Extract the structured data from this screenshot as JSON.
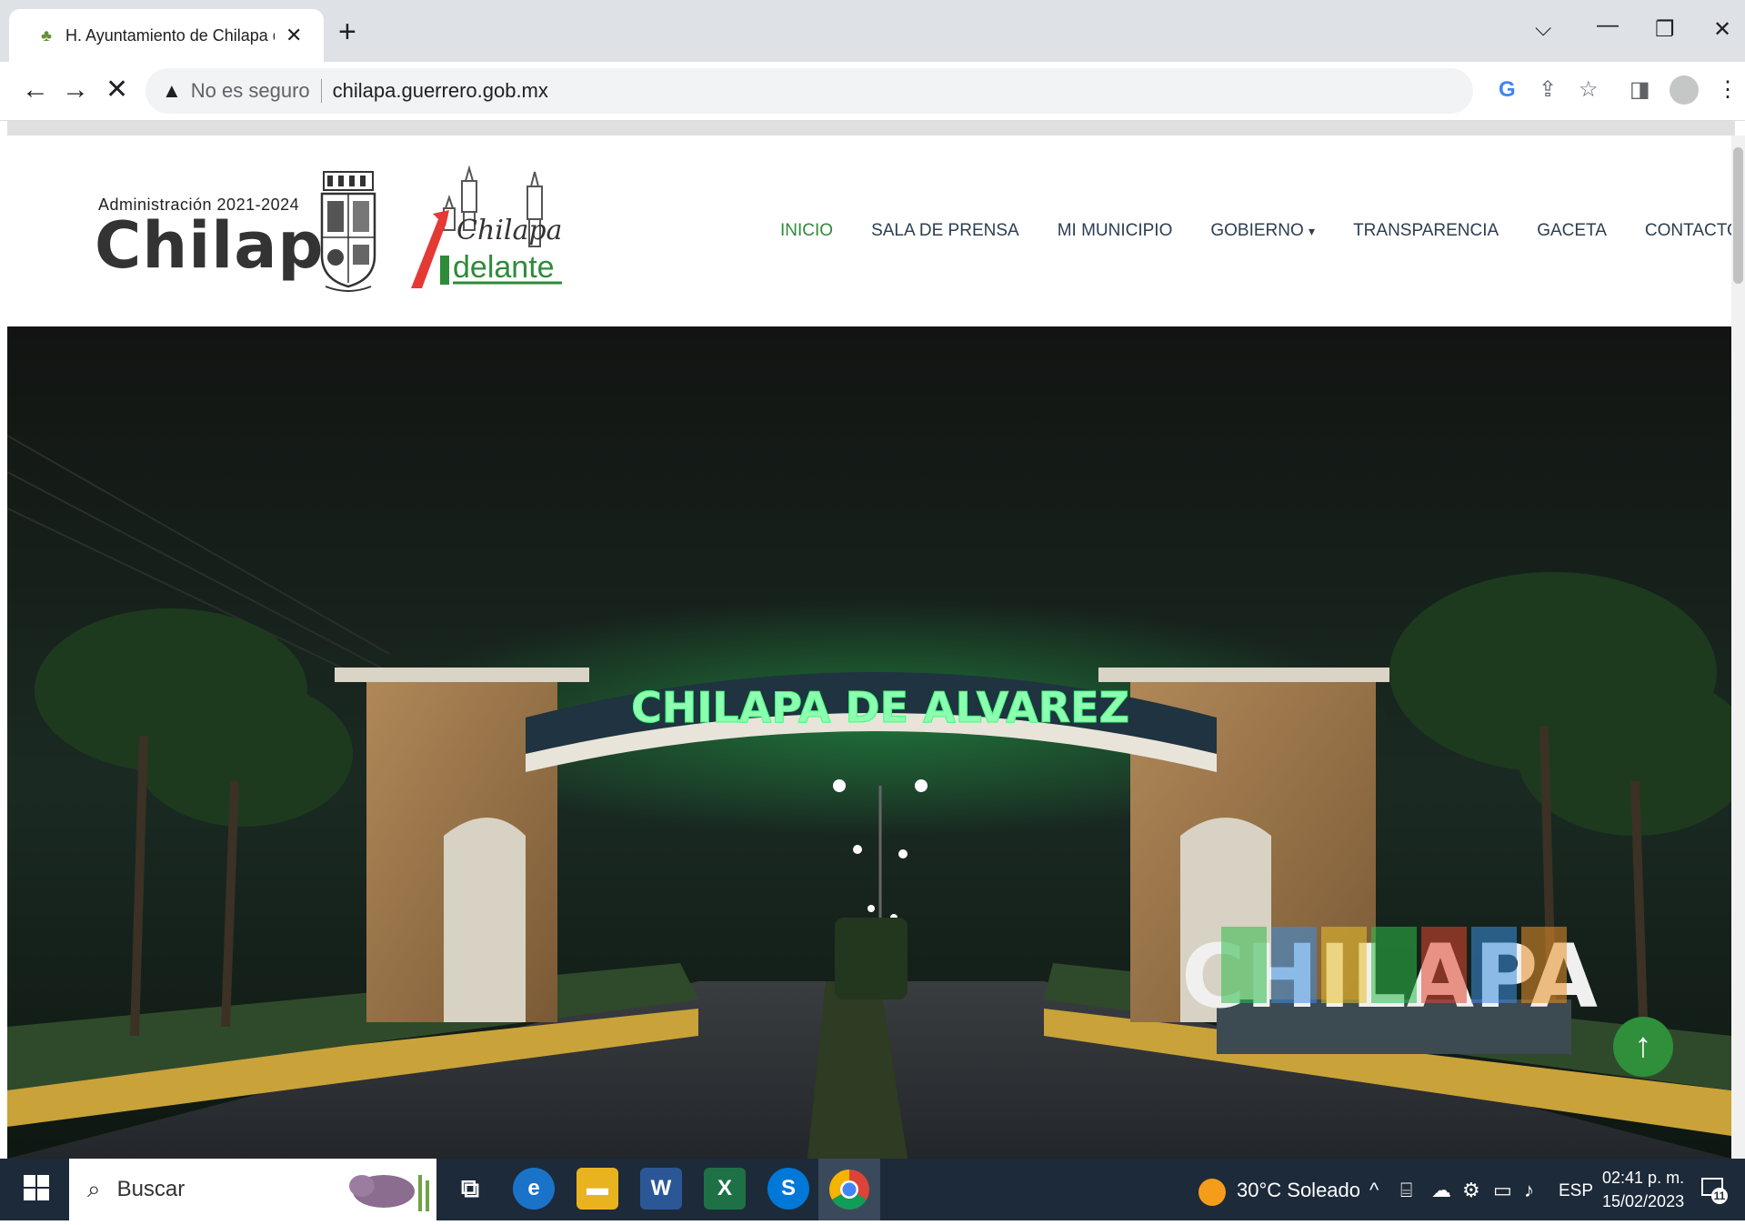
{
  "browser": {
    "tab_title": "H. Ayuntamiento de Chilapa de Á",
    "new_tab": "+",
    "security_label": "No es seguro",
    "url": "chilapa.guerrero.gob.mx"
  },
  "site": {
    "admin_text": "Administración 2021-2024",
    "logo_text": "Chilapa",
    "slogan_top": "Chilapa",
    "slogan_bottom": "delante",
    "nav": [
      "INICIO",
      "SALA DE PRENSA",
      "MI MUNICIPIO",
      "GOBIERNO",
      "TRANSPARENCIA",
      "GACETA",
      "CONTACTO"
    ],
    "hero_arch_text": "CHILAPA DE ALVAREZ",
    "hero_sign_text": "CHILAPA"
  },
  "taskbar": {
    "search_placeholder": "Buscar",
    "weather": "30°C  Soleado",
    "language": "ESP",
    "time": "02:41 p. m.",
    "date": "15/02/2023",
    "notifications": "11"
  },
  "colors": {
    "accent_green": "#2e8b3a",
    "taskbar_bg": "#1d2a3a",
    "chrome_bg": "#dee1e6"
  }
}
